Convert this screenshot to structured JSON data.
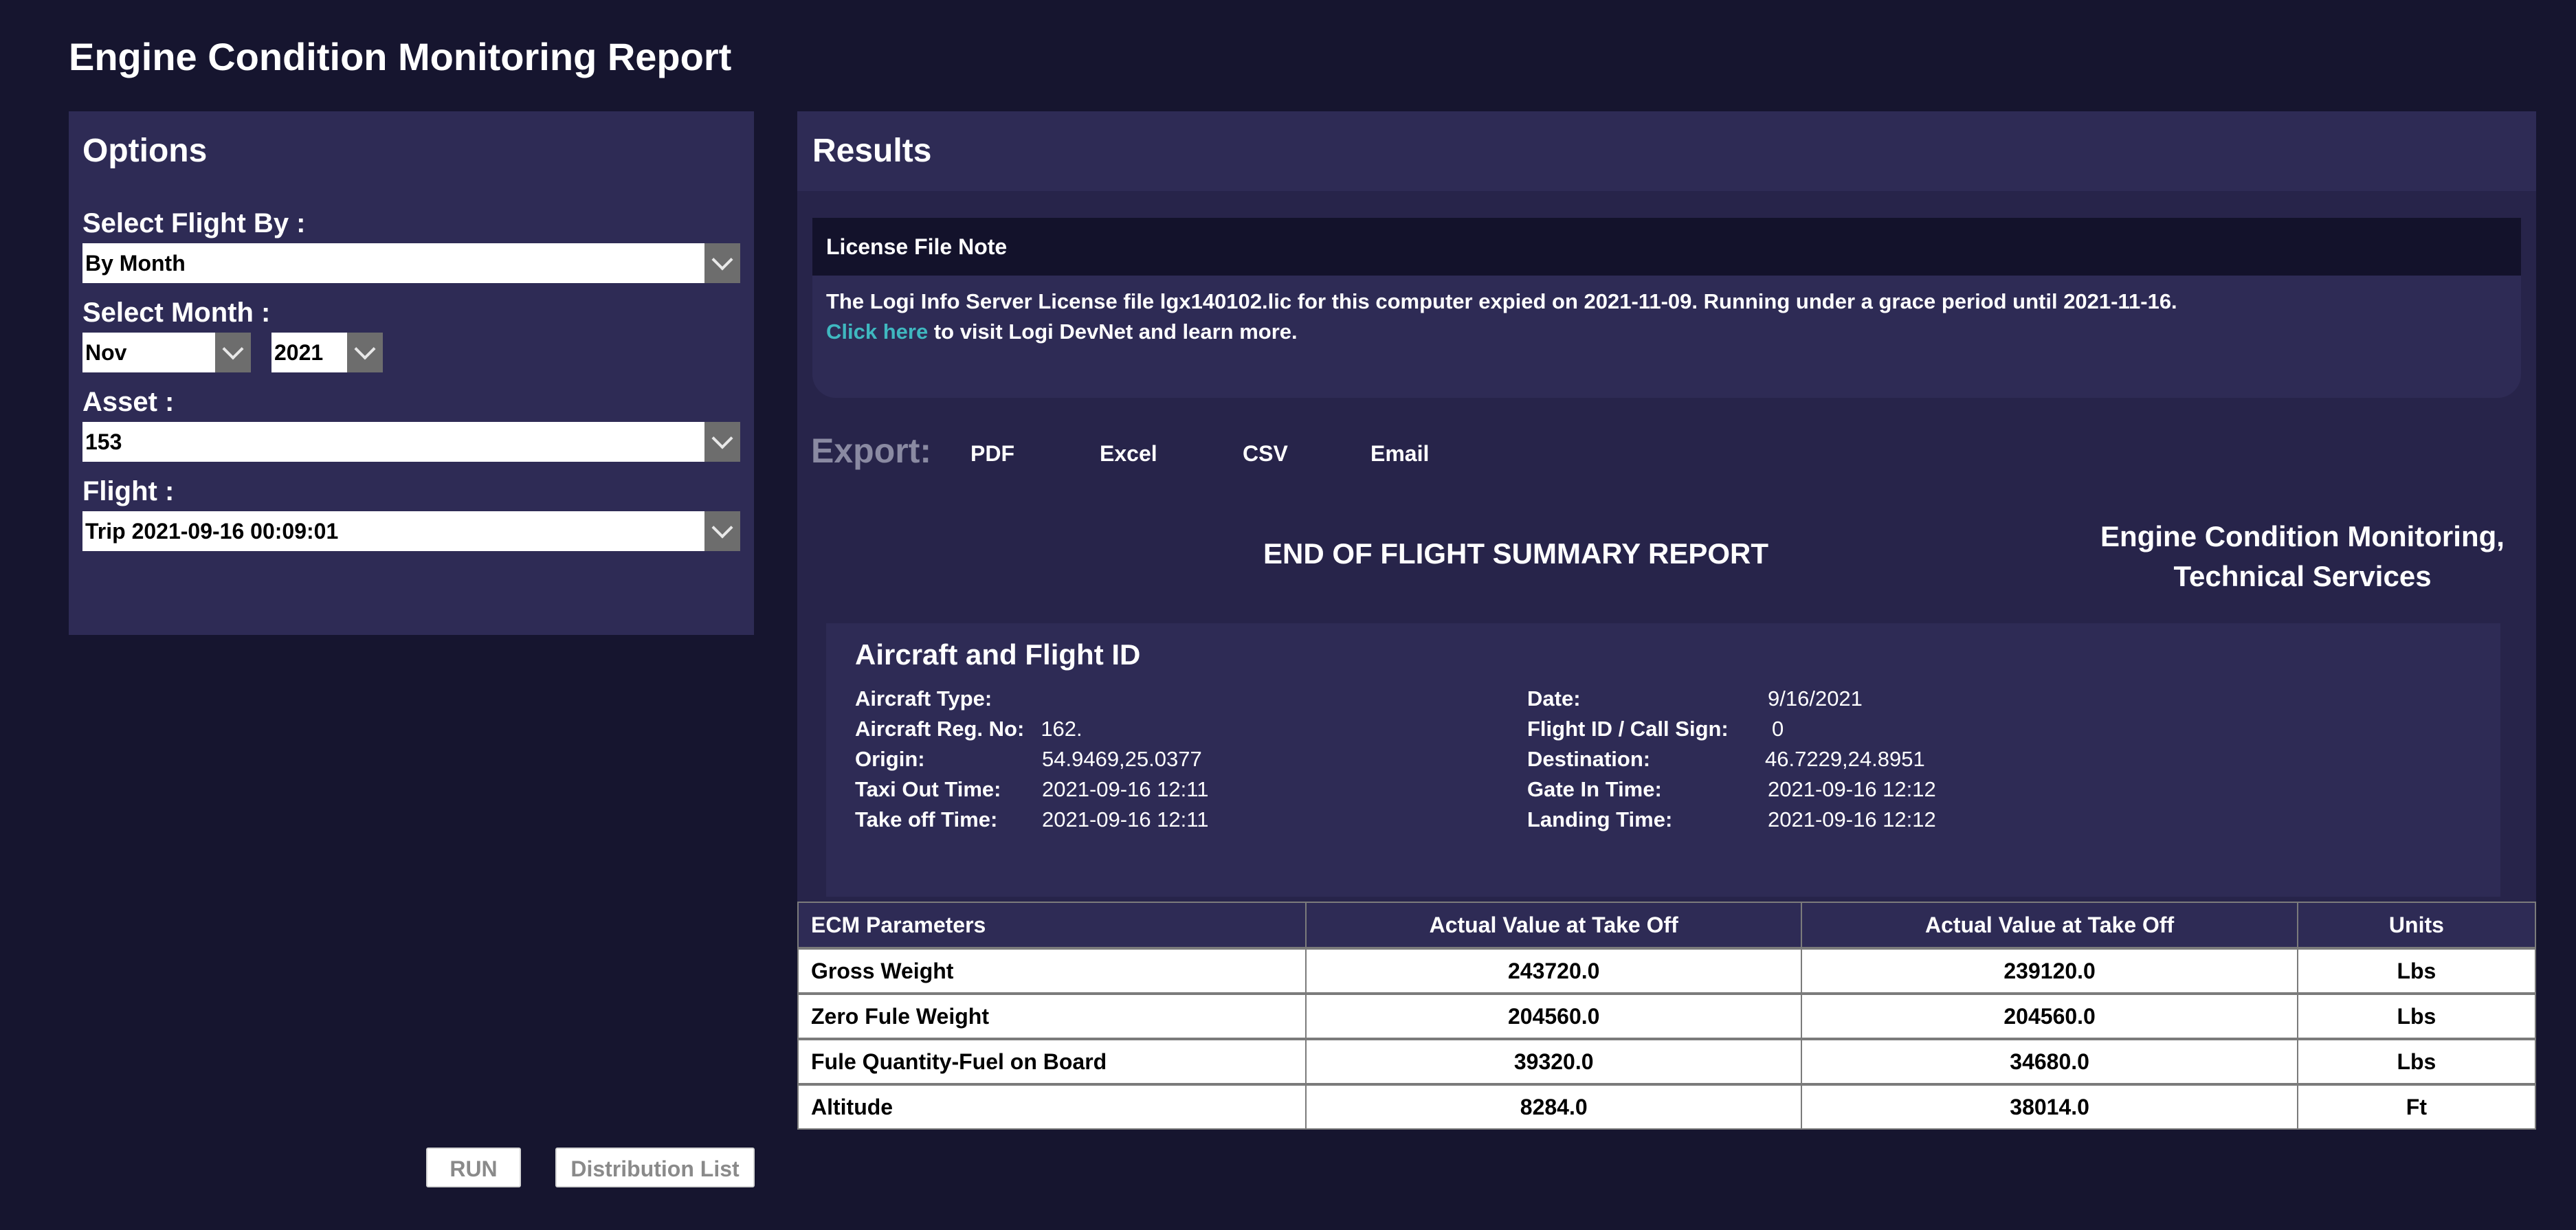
{
  "page": {
    "title": "Engine Condition Monitoring Report"
  },
  "options": {
    "heading": "Options",
    "select_flight_by": {
      "label": "Select Flight By :",
      "value": "By Month"
    },
    "select_month": {
      "label": "Select Month :",
      "month": "Nov",
      "year": "2021"
    },
    "asset": {
      "label": "Asset :",
      "value": "153"
    },
    "flight": {
      "label": "Flight :",
      "value": "Trip 2021-09-16 00:09:01"
    }
  },
  "buttons": {
    "run": "RUN",
    "distribution_list": "Distribution List"
  },
  "results": {
    "heading": "Results",
    "license": {
      "title": "License File Note",
      "message": "The Logi Info Server License file lgx140102.lic for this computer expied on 2021-11-09. Running under a grace period until 2021-11-16.",
      "link_text": "Click here",
      "link_suffix": " to visit Logi DevNet and learn more."
    },
    "export": {
      "label": "Export:",
      "items": [
        "PDF",
        "Excel",
        "CSV",
        "Email"
      ]
    },
    "report_title": "END OF FLIGHT SUMMARY REPORT",
    "org_line1": "Engine Condition Monitoring,",
    "org_line2": "Technical Services",
    "flight_box": {
      "heading": "Aircraft and Flight ID",
      "left": [
        {
          "key": "Aircraft Type:",
          "value": ""
        },
        {
          "key": "Aircraft Reg. No:",
          "value": "162."
        },
        {
          "key": "Origin:",
          "value": "54.9469,25.0377"
        },
        {
          "key": "Taxi Out Time:",
          "value": "2021-09-16 12:11"
        },
        {
          "key": "Take off Time:",
          "value": "2021-09-16 12:11"
        }
      ],
      "right": [
        {
          "key": "Date:",
          "value": "9/16/2021"
        },
        {
          "key": "Flight ID / Call Sign:",
          "value": "0"
        },
        {
          "key": "Destination:",
          "value": "46.7229,24.8951"
        },
        {
          "key": "Gate In Time:",
          "value": "2021-09-16 12:12"
        },
        {
          "key": "Landing Time:",
          "value": "2021-09-16 12:12"
        }
      ]
    },
    "table": {
      "headers": [
        "ECM Parameters",
        "Actual Value at Take Off",
        "Actual Value at Take Off",
        "Units"
      ],
      "rows": [
        [
          "Gross Weight",
          "243720.0",
          "239120.0",
          "Lbs"
        ],
        [
          "Zero Fule Weight",
          "204560.0",
          "204560.0",
          "Lbs"
        ],
        [
          "Fule Quantity-Fuel on Board",
          "39320.0",
          "34680.0",
          "Lbs"
        ],
        [
          "Altitude",
          "8284.0",
          "38014.0",
          "Ft"
        ]
      ]
    }
  }
}
